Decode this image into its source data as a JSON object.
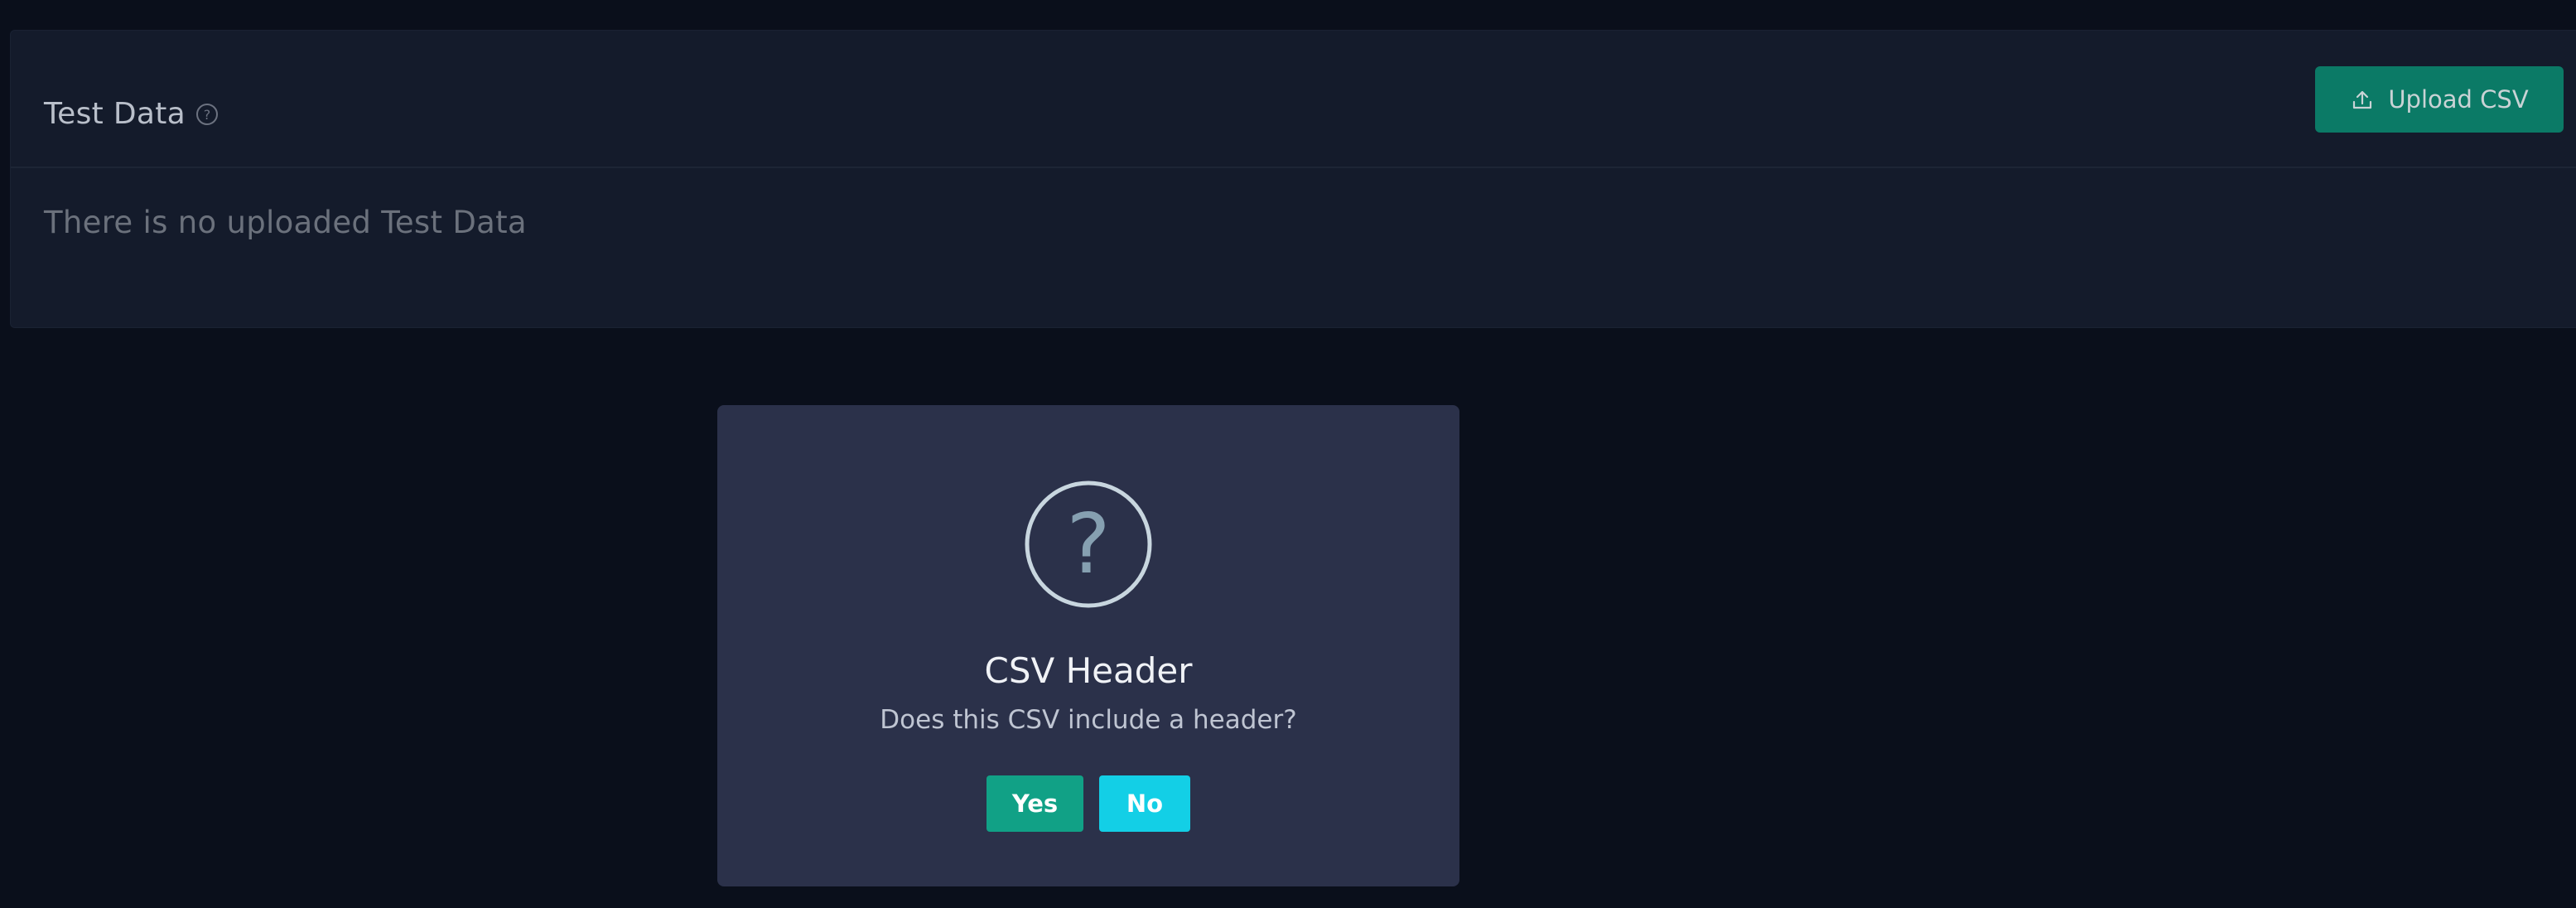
{
  "test_data_card": {
    "title": "Test Data",
    "help_icon": "question-circle-icon",
    "upload_button": {
      "label": "Upload CSV",
      "icon": "upload-icon"
    },
    "empty_message": "There is no uploaded Test Data"
  },
  "csv_header_dialog": {
    "icon": "question-circle-icon",
    "icon_glyph": "?",
    "title": "CSV Header",
    "message": "Does this CSV include a header?",
    "yes_label": "Yes",
    "no_label": "No"
  },
  "colors": {
    "background": "#0a0f1b",
    "card": "#141b2b",
    "upload_button": "#0b7a66",
    "modal": "#2b314a",
    "yes_button": "#11a186",
    "no_button": "#13cfe6"
  }
}
